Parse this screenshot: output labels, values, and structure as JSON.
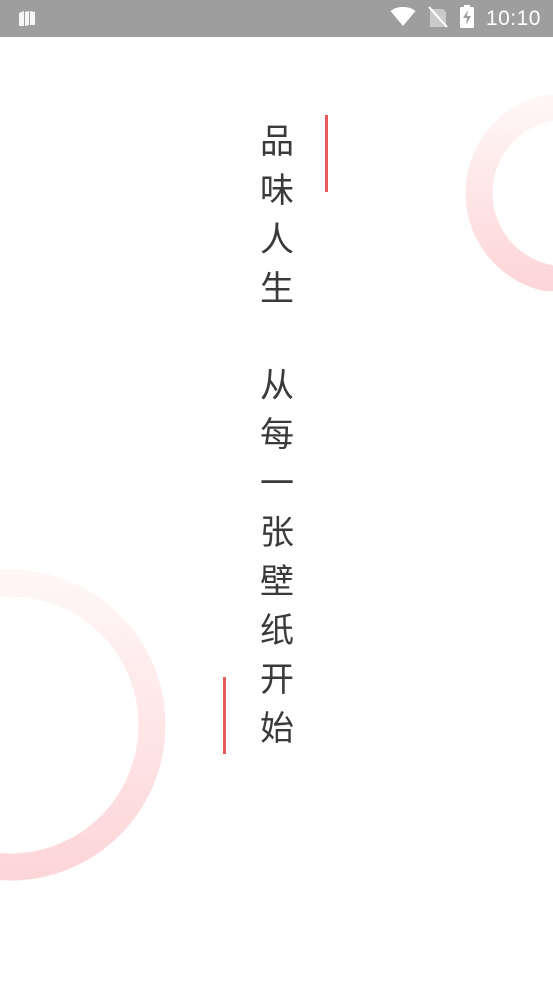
{
  "status_bar": {
    "time": "10:10",
    "icons": [
      "storage-icon",
      "wifi-icon",
      "no-sim-icon",
      "battery-charging-icon"
    ]
  },
  "slogan": {
    "line1": [
      "品",
      "味",
      "人",
      "生"
    ],
    "line2": [
      "从",
      "每",
      "一",
      "张",
      "壁",
      "纸",
      "开",
      "始"
    ]
  },
  "colors": {
    "status_bar_bg": "#9e9e9e",
    "accent": "#e75a5a",
    "ring": "#fdd7d9",
    "text": "#3a3a3a"
  }
}
